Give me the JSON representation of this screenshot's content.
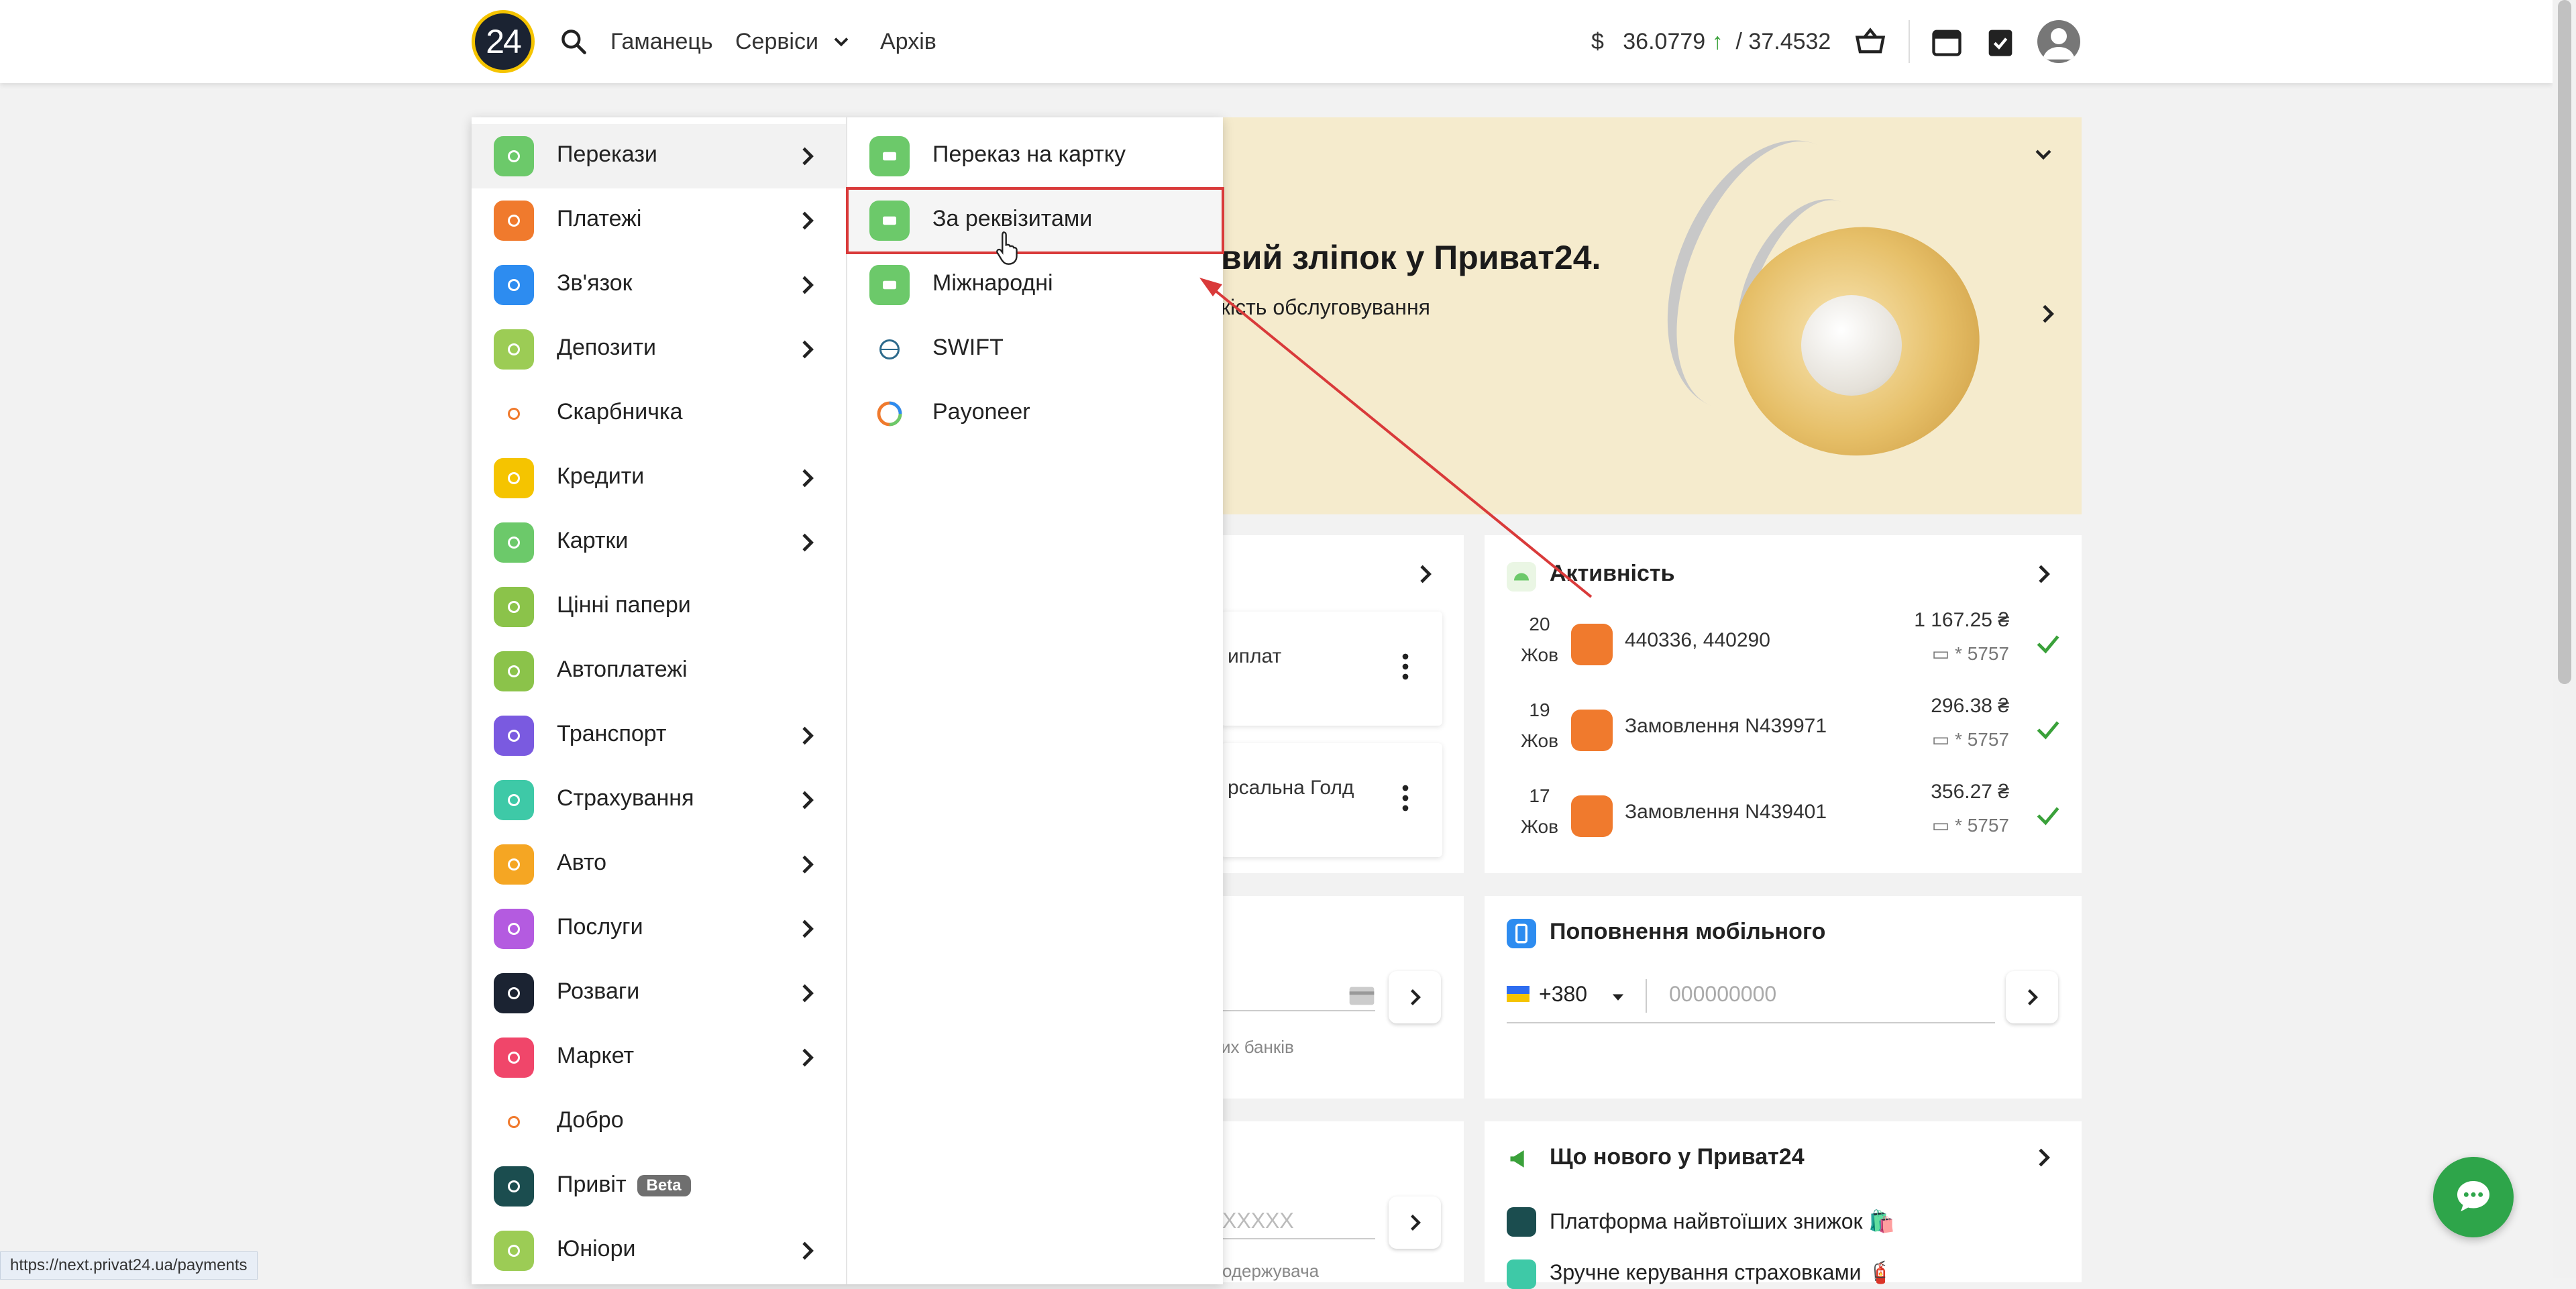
{
  "header": {
    "logo_text": "24",
    "nav": [
      "Гаманець",
      "Сервіси",
      "Архів"
    ],
    "rate_currency": "$",
    "rate_buy": "36.0779",
    "rate_up_arrow": "↑",
    "rate_sell": "/ 37.4532"
  },
  "banner": {
    "title": "вий зліпок у Приват24.",
    "subtitle": "кість обслуговування"
  },
  "left_cards": {
    "card1_text": "иплат",
    "card2_text": "рсальна Голд",
    "partial_hint": "их банків",
    "partial_placeholder": "XXXXX",
    "partial_sub": "одержувача"
  },
  "activity": {
    "title": "Активність",
    "rows": [
      {
        "day": "20",
        "month": "Жов",
        "name": "440336, 440290",
        "amount": "1 167.25 ₴",
        "card": "* 5757"
      },
      {
        "day": "19",
        "month": "Жов",
        "name": "Замовлення N439971",
        "amount": "296.38 ₴",
        "card": "* 5757"
      },
      {
        "day": "17",
        "month": "Жов",
        "name": "Замовлення N439401",
        "amount": "356.27 ₴",
        "card": "* 5757"
      }
    ]
  },
  "mobile": {
    "title": "Поповнення мобільного",
    "code": "+380",
    "placeholder": "000000000"
  },
  "news": {
    "title": "Що нового у Приват24",
    "items": [
      "Платформа найвтоїших знижок 🛍️",
      "Зручне керування страховками 🧯"
    ]
  },
  "menu": {
    "items": [
      {
        "label": "Перекази",
        "has_sub": true,
        "color": "#6cc96a",
        "icon": "transfer-icon"
      },
      {
        "label": "Платежі",
        "has_sub": true,
        "color": "#f07a2d",
        "icon": "payment-icon"
      },
      {
        "label": "Зв'язок",
        "has_sub": true,
        "color": "#2d8cf0",
        "icon": "signal-icon"
      },
      {
        "label": "Депозити",
        "has_sub": true,
        "color": "#9ccc55",
        "icon": "percent-icon"
      },
      {
        "label": "Скарбничка",
        "has_sub": false,
        "color": "#ffffff",
        "icon": "piggy-icon"
      },
      {
        "label": "Кредити",
        "has_sub": true,
        "color": "#f5c400",
        "icon": "money-bag-icon"
      },
      {
        "label": "Картки",
        "has_sub": true,
        "color": "#6cc96a",
        "icon": "card-icon"
      },
      {
        "label": "Цінні папери",
        "has_sub": false,
        "color": "#8bc34a",
        "icon": "document-icon"
      },
      {
        "label": "Автоплатежі",
        "has_sub": false,
        "color": "#8bc34a",
        "icon": "calendar-icon"
      },
      {
        "label": "Транспорт",
        "has_sub": true,
        "color": "#7a5ae0",
        "icon": "ticket-icon"
      },
      {
        "label": "Страхування",
        "has_sub": true,
        "color": "#3ec9a7",
        "icon": "umbrella-icon"
      },
      {
        "label": "Авто",
        "has_sub": true,
        "color": "#f5a623",
        "icon": "car-icon"
      },
      {
        "label": "Послуги",
        "has_sub": true,
        "color": "#b45be0",
        "icon": "puzzle-icon"
      },
      {
        "label": "Розваги",
        "has_sub": true,
        "color": "#1b2332",
        "icon": "smile-icon"
      },
      {
        "label": "Маркет",
        "has_sub": true,
        "color": "#f0466a",
        "icon": "cart-icon"
      },
      {
        "label": "Добро",
        "has_sub": false,
        "color": "#ffffff",
        "icon": "heart-icon"
      },
      {
        "label": "Привіт",
        "has_sub": false,
        "color": "#1b4d4f",
        "icon": "wave-hand-icon",
        "badge": "Beta"
      },
      {
        "label": "Юніори",
        "has_sub": true,
        "color": "#9ccc55",
        "icon": "helmet-icon"
      }
    ],
    "sub_items": [
      {
        "label": "Переказ на картку",
        "color": "#6cc96a",
        "icon": "card-transfer-icon"
      },
      {
        "label": "За реквізитами",
        "color": "#6cc96a",
        "icon": "requisites-icon"
      },
      {
        "label": "Міжнародні",
        "color": "#6cc96a",
        "icon": "globe-icon"
      },
      {
        "label": "SWIFT",
        "color": "#ffffff",
        "icon": "swift-icon"
      },
      {
        "label": "Payoneer",
        "color": "#ffffff",
        "icon": "payoneer-icon"
      }
    ]
  },
  "status_url": "https://next.privat24.ua/payments",
  "colors": {
    "accent_green": "#2ea54a",
    "highlight_red": "#d93a3a",
    "banner_bg": "#f5ebcd"
  }
}
